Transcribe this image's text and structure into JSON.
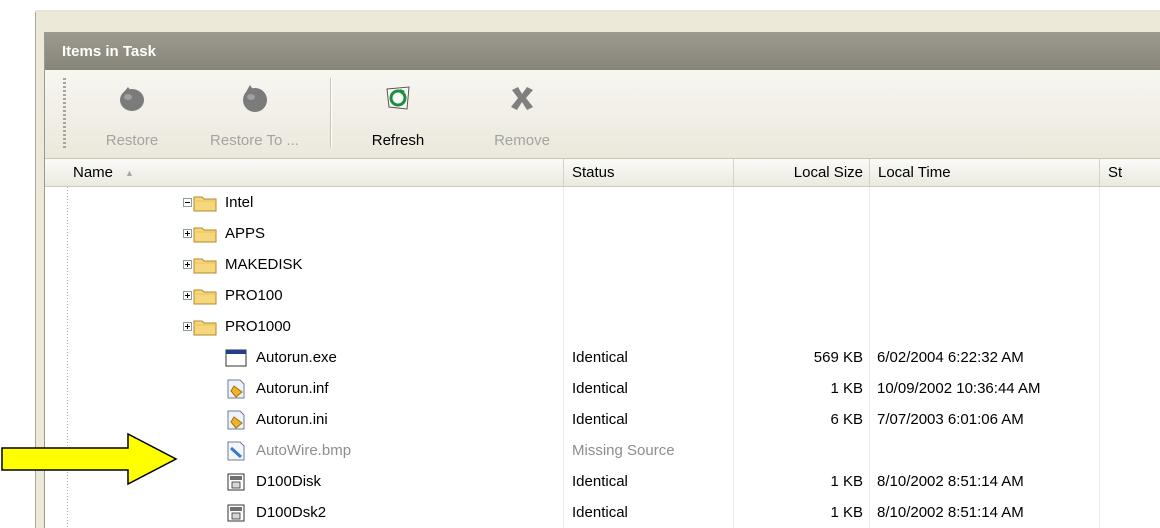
{
  "panel": {
    "title": "Items in Task"
  },
  "toolbar": {
    "restore": "Restore",
    "restore_to": "Restore To ...",
    "refresh": "Refresh",
    "remove": "Remove"
  },
  "columns": {
    "name": "Name",
    "sort_indicator": "▲",
    "status": "Status",
    "local_size": "Local Size",
    "local_time": "Local Time",
    "next": "St"
  },
  "rows": [
    {
      "name": "Intel",
      "type": "folder",
      "expander": "minus",
      "status": "",
      "size": "",
      "time": ""
    },
    {
      "name": "APPS",
      "type": "folder",
      "expander": "plus",
      "status": "",
      "size": "",
      "time": ""
    },
    {
      "name": "MAKEDISK",
      "type": "folder",
      "expander": "plus",
      "status": "",
      "size": "",
      "time": ""
    },
    {
      "name": "PRO100",
      "type": "folder",
      "expander": "plus",
      "status": "",
      "size": "",
      "time": ""
    },
    {
      "name": "PRO1000",
      "type": "folder",
      "expander": "plus",
      "status": "",
      "size": "",
      "time": ""
    },
    {
      "name": "Autorun.exe",
      "type": "exe",
      "status": "Identical",
      "size": "569 KB",
      "time": "6/02/2004 6:22:32 AM"
    },
    {
      "name": "Autorun.inf",
      "type": "inf",
      "status": "Identical",
      "size": "1 KB",
      "time": "10/09/2002 10:36:44 AM"
    },
    {
      "name": "Autorun.ini",
      "type": "inf",
      "status": "Identical",
      "size": "6 KB",
      "time": "7/07/2003 6:01:06 AM"
    },
    {
      "name": "AutoWire.bmp",
      "type": "bmp",
      "status": "Missing Source",
      "size": "",
      "time": "",
      "missing": true
    },
    {
      "name": "D100Disk",
      "type": "dsk",
      "status": "Identical",
      "size": "1 KB",
      "time": "8/10/2002 8:51:14 AM"
    },
    {
      "name": "D100Dsk2",
      "type": "dsk",
      "status": "Identical",
      "size": "1 KB",
      "time": "8/10/2002 8:51:14 AM"
    }
  ],
  "colors": {
    "title_bar": "#8f8c81",
    "arrow_fill": "#ffff00",
    "missing_text": "#8d8d8d"
  }
}
